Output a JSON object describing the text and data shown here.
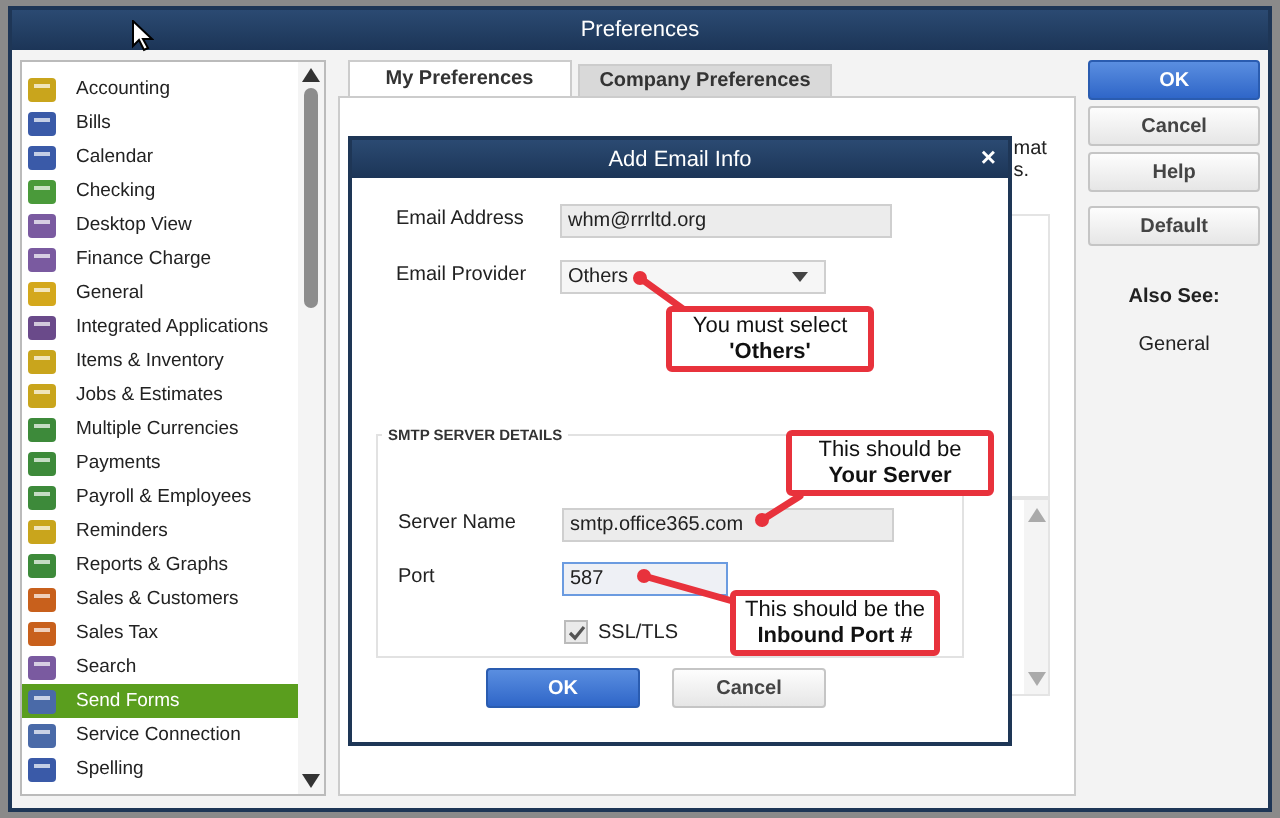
{
  "window": {
    "title": "Preferences"
  },
  "categories": [
    {
      "label": "Accounting",
      "selected": false
    },
    {
      "label": "Bills",
      "selected": false
    },
    {
      "label": "Calendar",
      "selected": false
    },
    {
      "label": "Checking",
      "selected": false
    },
    {
      "label": "Desktop View",
      "selected": false
    },
    {
      "label": "Finance Charge",
      "selected": false
    },
    {
      "label": "General",
      "selected": false
    },
    {
      "label": "Integrated Applications",
      "selected": false
    },
    {
      "label": "Items & Inventory",
      "selected": false
    },
    {
      "label": "Jobs & Estimates",
      "selected": false
    },
    {
      "label": "Multiple Currencies",
      "selected": false
    },
    {
      "label": "Payments",
      "selected": false
    },
    {
      "label": "Payroll & Employees",
      "selected": false
    },
    {
      "label": "Reminders",
      "selected": false
    },
    {
      "label": "Reports & Graphs",
      "selected": false
    },
    {
      "label": "Sales & Customers",
      "selected": false
    },
    {
      "label": "Sales Tax",
      "selected": false
    },
    {
      "label": "Search",
      "selected": false
    },
    {
      "label": "Send Forms",
      "selected": true
    },
    {
      "label": "Service Connection",
      "selected": false
    },
    {
      "label": "Spelling",
      "selected": false
    }
  ],
  "tabs": [
    {
      "label": "My Preferences",
      "selected": true
    },
    {
      "label": "Company Preferences",
      "selected": false
    }
  ],
  "background_text": [
    "mat",
    "s."
  ],
  "buttons": [
    {
      "label": "OK",
      "kind": "primary"
    },
    {
      "label": "Cancel",
      "kind": "default"
    },
    {
      "label": "Help",
      "kind": "default"
    },
    {
      "label": "Default",
      "kind": "default"
    }
  ],
  "also_see": {
    "title": "Also See:",
    "links": [
      "General"
    ]
  },
  "dialog": {
    "title": "Add Email Info",
    "close": "×",
    "fields": [
      {
        "label": "Email Address",
        "value": "whm@rrrltd.org",
        "kind": "text"
      },
      {
        "label": "Email Provider",
        "value": "Others",
        "kind": "dropdown"
      }
    ],
    "section_title": "SMTP SERVER DETAILS",
    "server_fields": [
      {
        "label": "Server Name",
        "value": "smtp.office365.com",
        "kind": "text",
        "focused": false
      },
      {
        "label": "Port",
        "value": "587",
        "kind": "text",
        "focused": true
      }
    ],
    "ssl": {
      "label": "SSL/TLS",
      "checked": true
    },
    "buttons": [
      {
        "label": "OK",
        "kind": "primary"
      },
      {
        "label": "Cancel",
        "kind": "default"
      }
    ]
  },
  "callouts": [
    {
      "lines": [
        "You must select",
        "**'Others'**"
      ]
    },
    {
      "lines": [
        "This should be",
        "**Your Server**"
      ]
    },
    {
      "lines": [
        "This should be the",
        "**Inbound Port #**"
      ]
    }
  ]
}
